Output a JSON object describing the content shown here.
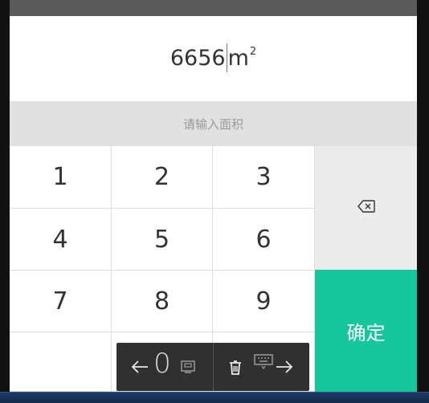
{
  "display": {
    "value": "6656",
    "unit": "m",
    "unit_sup": "2"
  },
  "hint": {
    "text": "请输入面积"
  },
  "keys": [
    "1",
    "2",
    "3",
    "4",
    "5",
    "6",
    "7",
    "8",
    "9",
    "0"
  ],
  "confirm_label": "确定",
  "icons": {
    "backspace": "backspace-icon",
    "arrow_left": "arrow-left-icon",
    "arrow_right": "arrow-right-icon",
    "trash": "trash-icon",
    "screen": "screen-icon",
    "keyboard": "keyboard-icon"
  },
  "colors": {
    "confirm": "#16c79d",
    "hint_bg": "#e1e1e1",
    "toolbar_bg": "#303030"
  }
}
